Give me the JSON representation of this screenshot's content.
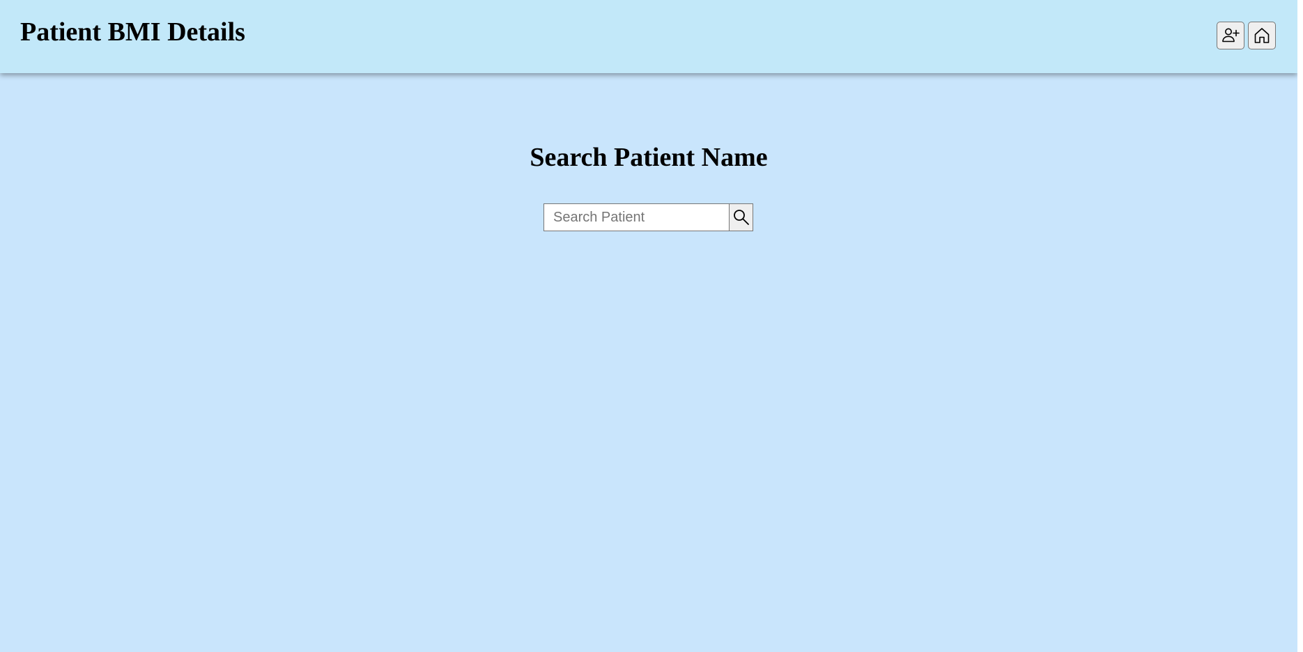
{
  "header": {
    "title": "Patient BMI Details",
    "add_patient_icon": "person-plus-icon",
    "home_icon": "house-icon"
  },
  "main": {
    "heading": "Search Patient Name",
    "search": {
      "placeholder": "Search Patient",
      "value": "",
      "icon": "search-icon"
    }
  },
  "colors": {
    "header_background": "#c2e8f9",
    "page_background": "#c9e5fc",
    "button_background": "#efefef",
    "border": "#767676"
  }
}
